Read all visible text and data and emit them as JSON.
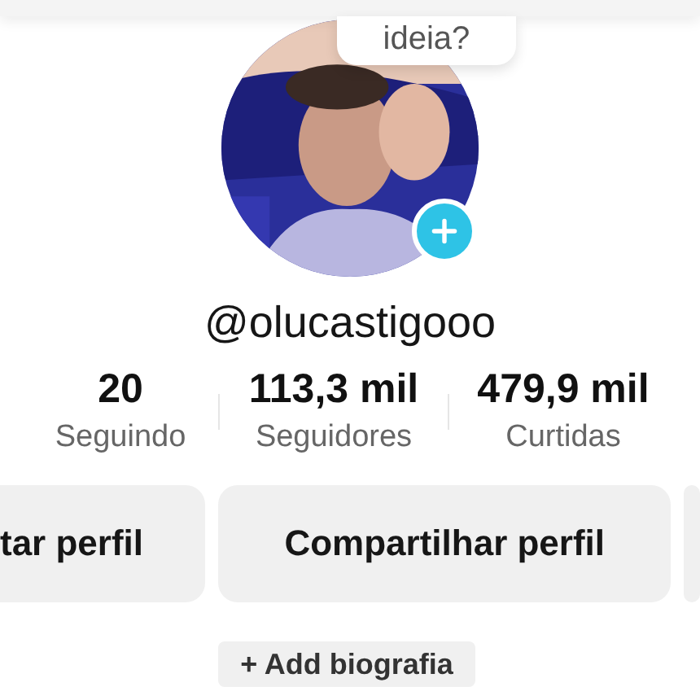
{
  "note_bubble": {
    "text": "ideia?"
  },
  "avatar": {
    "kind": "picture",
    "add_badge": true
  },
  "username": "@olucastigooo",
  "stats": [
    {
      "value": "20",
      "label": "Seguindo"
    },
    {
      "value": "113,3 mil",
      "label": "Seguidores"
    },
    {
      "value": "479,9 mil",
      "label": "Curtidas"
    }
  ],
  "buttons": [
    {
      "label": "tar perfil"
    },
    {
      "label": "Compartilhar perfil"
    }
  ],
  "bio_button": {
    "label": "+ Add biografia"
  }
}
